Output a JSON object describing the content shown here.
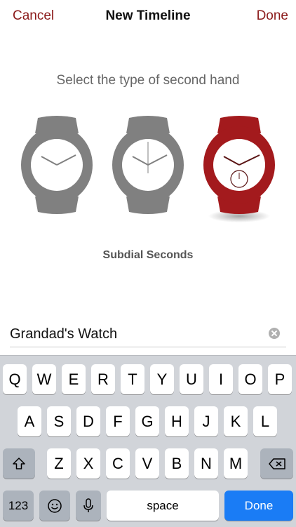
{
  "nav": {
    "cancel": "Cancel",
    "title": "New Timeline",
    "done": "Done"
  },
  "prompt": "Select the type of second hand",
  "watches": [
    {
      "type": "no-seconds",
      "selected": false
    },
    {
      "type": "sweep-seconds",
      "selected": false
    },
    {
      "type": "subdial-seconds",
      "selected": true
    }
  ],
  "selected_label": "Subdial Seconds",
  "name_field": {
    "value": "Grandad's Watch"
  },
  "colors": {
    "accent": "#8b1a1a",
    "watch_gray": "#808080",
    "watch_selected": "#a31a1d",
    "key_blue": "#1a7cf5"
  },
  "keyboard": {
    "row1": [
      "Q",
      "W",
      "E",
      "R",
      "T",
      "Y",
      "U",
      "I",
      "O",
      "P"
    ],
    "row2": [
      "A",
      "S",
      "D",
      "F",
      "G",
      "H",
      "J",
      "K",
      "L"
    ],
    "row3": [
      "Z",
      "X",
      "C",
      "V",
      "B",
      "N",
      "M"
    ],
    "numbers": "123",
    "space": "space",
    "done": "Done"
  }
}
